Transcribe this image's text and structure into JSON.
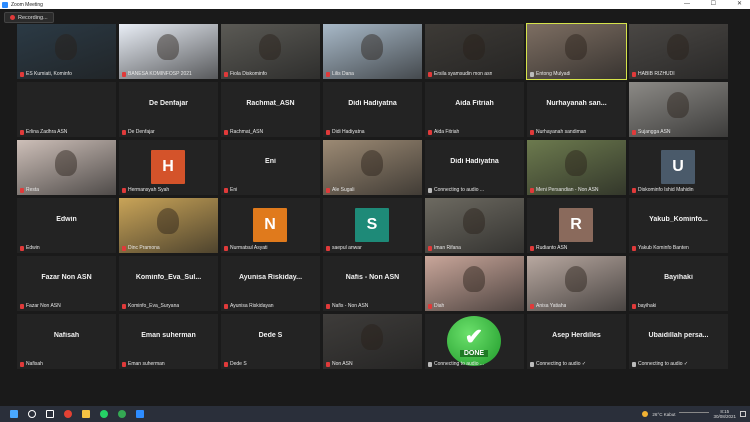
{
  "window": {
    "title": "Zoom Meeting",
    "minimize": "—",
    "maximize": "☐",
    "close": "✕"
  },
  "recording": {
    "label": "Recording..."
  },
  "participants": [
    {
      "label": "ES Kumiati, Kominfo",
      "muted": true,
      "kind": "video",
      "bg": "#2b3a45"
    },
    {
      "label": "BANESA KOMINFOSP 2021",
      "muted": true,
      "kind": "video",
      "bg": "#e9eef6"
    },
    {
      "label": "Fiola Diskominfo",
      "muted": true,
      "kind": "video",
      "bg": "#5b5a55"
    },
    {
      "label": "Lilis Dana",
      "muted": true,
      "kind": "video",
      "bg": "#a8b9c8"
    },
    {
      "label": "Ersila syamsudin mon asn",
      "muted": true,
      "kind": "video",
      "bg": "#3d3a36"
    },
    {
      "label": "Entong Mulyadi",
      "muted": false,
      "kind": "video",
      "bg": "#7d6e62",
      "active": true
    },
    {
      "label": "HABIB RIZHUDI",
      "muted": true,
      "kind": "video",
      "bg": "#4a4744"
    },
    {
      "label": "Erlina Zadhra ASN",
      "muted": true,
      "kind": "name",
      "name": ""
    },
    {
      "label": "De Denfajar",
      "muted": true,
      "kind": "name",
      "name": "De Denfajar"
    },
    {
      "label": "Rachmat_ASN",
      "muted": true,
      "kind": "name",
      "name": "Rachmat_ASN"
    },
    {
      "label": "Didi Hadiyatna",
      "muted": true,
      "kind": "name",
      "name": "Didi Hadiyatna"
    },
    {
      "label": "Aida Fitriah",
      "muted": true,
      "kind": "name",
      "name": "Aida Fitriah"
    },
    {
      "label": "Nurhayanah sandiman",
      "muted": true,
      "kind": "name",
      "name": "Nurhayanah san..."
    },
    {
      "label": "Sujangga ASN",
      "muted": true,
      "kind": "video",
      "bg": "#8c8a86"
    },
    {
      "label": "Resta",
      "muted": true,
      "kind": "video",
      "bg": "#cdbfb8"
    },
    {
      "label": "Hermansyah Syah",
      "muted": true,
      "kind": "avatar",
      "letter": "H",
      "color": "#d4532a"
    },
    {
      "label": "Eni",
      "muted": true,
      "kind": "name",
      "name": "Eni"
    },
    {
      "label": "Ale Sugali",
      "muted": true,
      "kind": "video",
      "bg": "#9c8a74"
    },
    {
      "label": "Connecting to audio ...",
      "muted": false,
      "kind": "name",
      "name": "Didi Hadiyatna"
    },
    {
      "label": "Meni Persandian - Non ASN",
      "muted": true,
      "kind": "video",
      "bg": "#6c7a4e"
    },
    {
      "label": "Diskominfo Ishid Mahidin",
      "muted": true,
      "kind": "avatar",
      "letter": "U",
      "color": "#4a5a6a"
    },
    {
      "label": "Edwin",
      "muted": true,
      "kind": "name",
      "name": "Edwin"
    },
    {
      "label": "Dinc Pramona",
      "muted": true,
      "kind": "video",
      "bg": "#c9a458"
    },
    {
      "label": "Nurmatsul Asyati",
      "muted": true,
      "kind": "avatar",
      "letter": "N",
      "color": "#e07a1c"
    },
    {
      "label": "saepul anwar",
      "muted": true,
      "kind": "avatar",
      "letter": "S",
      "color": "#1e8a78"
    },
    {
      "label": "Iman Rifana",
      "muted": true,
      "kind": "video",
      "bg": "#6d6a61"
    },
    {
      "label": "Rudianto ASN",
      "muted": true,
      "kind": "avatar",
      "letter": "R",
      "color": "#8a6a5c"
    },
    {
      "label": "Yakub Kominfo Banten",
      "muted": true,
      "kind": "name",
      "name": "Yakub_Kominfo..."
    },
    {
      "label": "Fazar Non ASN",
      "muted": true,
      "kind": "name",
      "name": "Fazar Non ASN"
    },
    {
      "label": "Kominfo_Eva_Suryana",
      "muted": true,
      "kind": "name",
      "name": "Kominfo_Eva_Sul..."
    },
    {
      "label": "Ayunisa Riskidayan",
      "muted": true,
      "kind": "name",
      "name": "Ayunisa Riskiday..."
    },
    {
      "label": "Nafis - Non ASN",
      "muted": true,
      "kind": "name",
      "name": "Nafis - Non ASN"
    },
    {
      "label": "Diah",
      "muted": true,
      "kind": "video",
      "bg": "#c9a69a"
    },
    {
      "label": "Anisa Yatiaha",
      "muted": true,
      "kind": "video",
      "bg": "#b8a8a0"
    },
    {
      "label": "bayihaki",
      "muted": true,
      "kind": "name",
      "name": "Bayihaki"
    },
    {
      "label": "Nafisah",
      "muted": true,
      "kind": "name",
      "name": "Nafisah"
    },
    {
      "label": "Eman suherman",
      "muted": true,
      "kind": "name",
      "name": "Eman suherman"
    },
    {
      "label": "Dede S",
      "muted": true,
      "kind": "name",
      "name": "Dede S"
    },
    {
      "label": "Non ASN",
      "muted": true,
      "kind": "video",
      "bg": "#3e3c3a"
    },
    {
      "label": "Connecting to audio ...",
      "muted": false,
      "kind": "done",
      "doneText": "DONE"
    },
    {
      "label": "Connecting to audio ✓",
      "muted": false,
      "kind": "name",
      "name": "Asep Herdilles"
    },
    {
      "label": "Connecting to audio ✓",
      "muted": false,
      "kind": "name",
      "name": "Ubaidillah persa..."
    }
  ],
  "taskbar": {
    "weather": "26°C Kabut",
    "time": "8:15",
    "date": "30/08/2021",
    "apps": [
      {
        "icon": "windows-icon",
        "color": "#4aa8ff"
      },
      {
        "icon": "search-icon",
        "color": "#ffffff"
      },
      {
        "icon": "taskview-icon",
        "color": "#ffffff"
      },
      {
        "icon": "chrome-icon",
        "color": "#e34133"
      },
      {
        "icon": "explorer-icon",
        "color": "#f5c343"
      },
      {
        "icon": "whatsapp-icon",
        "color": "#25d366"
      },
      {
        "icon": "chrome2-icon",
        "color": "#34a853"
      },
      {
        "icon": "zoom-icon",
        "color": "#2d8cff"
      }
    ]
  }
}
